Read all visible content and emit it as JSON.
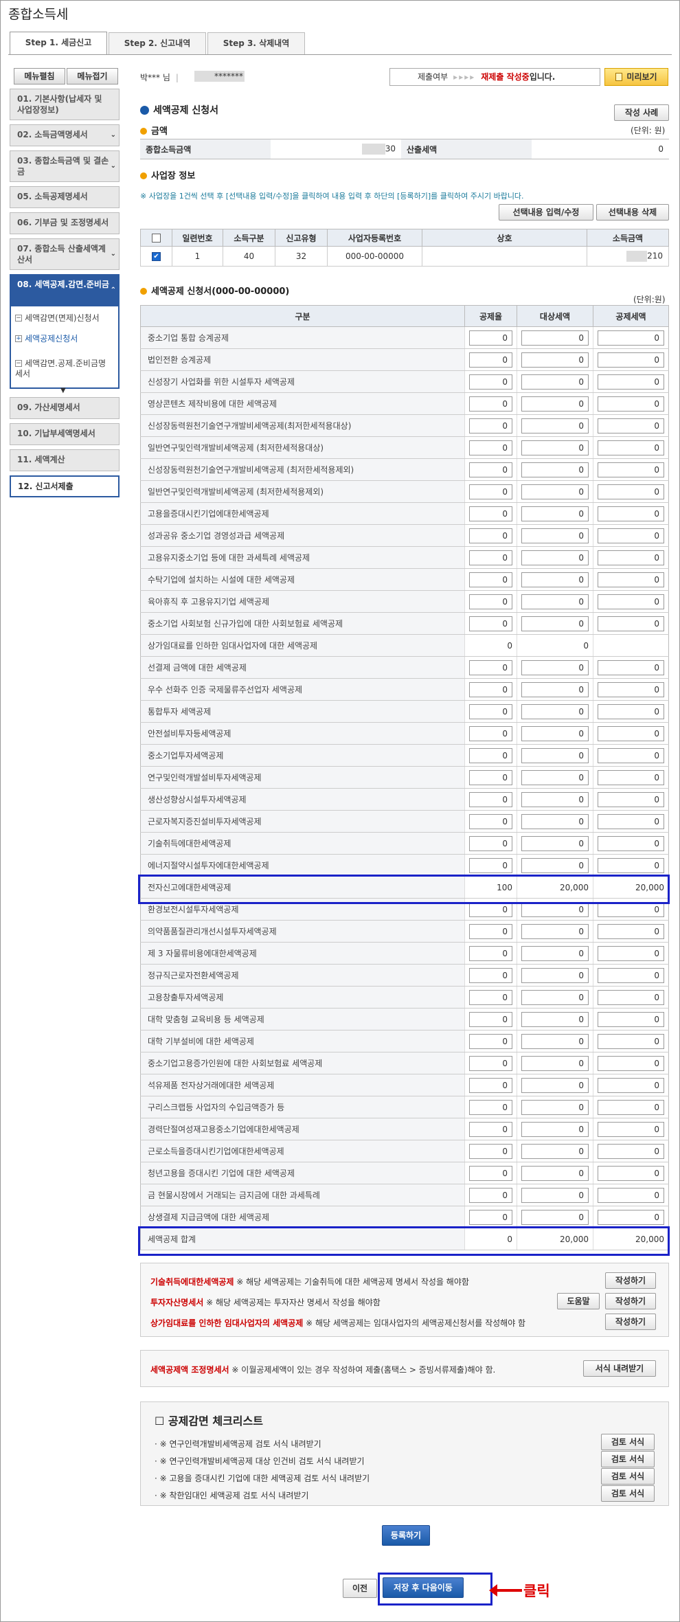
{
  "page_title": "종합소득세",
  "tabs": [
    {
      "label": "Step 1. 세금신고"
    },
    {
      "label": "Step 2. 신고내역"
    },
    {
      "label": "Step 3. 삭제내역"
    }
  ],
  "left_menu": {
    "expand_label": "메뉴펼침",
    "collapse_label": "메뉴접기",
    "items": [
      {
        "label": "01. 기본사항(납세자 및 사업장정보)"
      },
      {
        "label": "02. 소득금액명세서"
      },
      {
        "label": "03. 종합소득금액 및 결손금"
      },
      {
        "label": "05. 소득공제명세서"
      },
      {
        "label": "06. 기부금 및 조정명세서"
      },
      {
        "label": "07. 종합소득 산출세액계산서"
      },
      {
        "label": "08. 세액공제.감면.준비금"
      },
      {
        "label": "09. 가산세명세서"
      },
      {
        "label": "10. 기납부세액명세서"
      },
      {
        "label": "11. 세액계산"
      },
      {
        "label": "12. 신고서제출"
      }
    ],
    "submenu": [
      {
        "label": "세액감면(면제)신청서"
      },
      {
        "label": "세액공제신청서"
      },
      {
        "label": "세액감면.공제.준비금명세서"
      }
    ]
  },
  "header": {
    "user_name": "박*** 님",
    "user_id": "*******",
    "status_label": "제출여부",
    "status_arrows": "▸▸▸▸",
    "status_value": "재제출 작성중",
    "status_suffix": "입니다.",
    "preview_label": "미리보기"
  },
  "section1": {
    "title": "세액공제 신청서",
    "sample_button": "작성 사례",
    "amount_title": "금액",
    "unit": "(단위: 원)",
    "income_label": "종합소득금액",
    "income_value": "30",
    "calc_tax_label": "산출세액",
    "calc_tax_value": "0"
  },
  "biz": {
    "title": "사업장 정보",
    "notice": "※ 사업장을 1건씩 선택 후 [선택내용 입력/수정]을 클릭하여 내용 입력 후 하단의 [등록하기]를 클릭하여 주시기 바랍니다.",
    "btn_edit": "선택내용 입력/수정",
    "btn_delete": "선택내용 삭제",
    "columns": [
      "일련번호",
      "소득구분",
      "신고유형",
      "사업자등록번호",
      "상호",
      "소득금액"
    ],
    "row": {
      "serial": "1",
      "income_type": "40",
      "report_type": "32",
      "reg_no": "000-00-00000",
      "trade_name": "",
      "amount": "210"
    }
  },
  "credit": {
    "title": "세액공제 신청서(000-00-00000)",
    "unit": "(단위:원)",
    "columns": [
      "구분",
      "공제율",
      "대상세액",
      "공제세액"
    ],
    "rows": [
      {
        "name": "중소기업 통합 승계공제",
        "rate": "0",
        "target": "0",
        "credit": "0",
        "input": true
      },
      {
        "name": "법인전환 승계공제",
        "rate": "0",
        "target": "0",
        "credit": "0",
        "input": true
      },
      {
        "name": "신성장기 사업화를 위한 시설투자 세액공제",
        "rate": "0",
        "target": "0",
        "credit": "0",
        "input": true
      },
      {
        "name": "영상콘텐츠 제작비용에 대한 세액공제",
        "rate": "0",
        "target": "0",
        "credit": "0",
        "input": true
      },
      {
        "name": "신성장동력원천기술연구개발비세액공제(최저한세적용대상)",
        "rate": "0",
        "target": "0",
        "credit": "0",
        "input": true
      },
      {
        "name": "일반연구및인력개발비세액공제 (최저한세적용대상)",
        "rate": "0",
        "target": "0",
        "credit": "0",
        "input": true
      },
      {
        "name": "신성장동력원천기술연구개발비세액공제 (최저한세적용제외)",
        "rate": "0",
        "target": "0",
        "credit": "0",
        "input": true
      },
      {
        "name": "일반연구및인력개발비세액공제 (최저한세적용제외)",
        "rate": "0",
        "target": "0",
        "credit": "0",
        "input": true
      },
      {
        "name": "고용을증대시킨기업에대한세액공제",
        "rate": "0",
        "target": "0",
        "credit": "0",
        "input": true
      },
      {
        "name": "성과공유 중소기업 경영성과급 세액공제",
        "rate": "0",
        "target": "0",
        "credit": "0",
        "input": true
      },
      {
        "name": "고용유지중소기업 등에 대한 과세특례 세액공제",
        "rate": "0",
        "target": "0",
        "credit": "0",
        "input": true
      },
      {
        "name": "수탁기업에 설치하는 시설에 대한 세액공제",
        "rate": "0",
        "target": "0",
        "credit": "0",
        "input": true
      },
      {
        "name": "육아휴직 후 고용유지기업 세액공제",
        "rate": "0",
        "target": "0",
        "credit": "0",
        "input": true
      },
      {
        "name": "중소기업 사회보험 신규가입에 대한 사회보험료 세액공제",
        "rate": "0",
        "target": "0",
        "credit": "0",
        "input": true
      },
      {
        "name": "상가임대료를 인하한 임대사업자에 대한 세액공제",
        "rate": "0",
        "target": "0",
        "credit": "",
        "input": false
      },
      {
        "name": "선결제 금액에 대한 세액공제",
        "rate": "0",
        "target": "0",
        "credit": "0",
        "input": true
      },
      {
        "name": "우수 선화주 인증 국제물류주선업자 세액공제",
        "rate": "0",
        "target": "0",
        "credit": "0",
        "input": true
      },
      {
        "name": "통합투자 세액공제",
        "rate": "0",
        "target": "0",
        "credit": "0",
        "input": true
      },
      {
        "name": "안전설비투자등세액공제",
        "rate": "0",
        "target": "0",
        "credit": "0",
        "input": true
      },
      {
        "name": "중소기업투자세액공제",
        "rate": "0",
        "target": "0",
        "credit": "0",
        "input": true
      },
      {
        "name": "연구및인력개발설비투자세액공제",
        "rate": "0",
        "target": "0",
        "credit": "0",
        "input": true
      },
      {
        "name": "생산성향상시설투자세액공제",
        "rate": "0",
        "target": "0",
        "credit": "0",
        "input": true
      },
      {
        "name": "근로자복지증진설비투자세액공제",
        "rate": "0",
        "target": "0",
        "credit": "0",
        "input": true
      },
      {
        "name": "기술취득에대한세액공제",
        "rate": "0",
        "target": "0",
        "credit": "0",
        "input": true
      },
      {
        "name": "에너지절약시설투자에대한세액공제",
        "rate": "0",
        "target": "0",
        "credit": "0",
        "input": true
      },
      {
        "name": "전자신고에대한세액공제",
        "rate": "100",
        "target": "20,000",
        "credit": "20,000",
        "input": false
      },
      {
        "name": "환경보전시설투자세액공제",
        "rate": "0",
        "target": "0",
        "credit": "0",
        "input": true
      },
      {
        "name": "의약품품질관리개선시설투자세액공제",
        "rate": "0",
        "target": "0",
        "credit": "0",
        "input": true
      },
      {
        "name": "제 3 자물류비용에대한세액공제",
        "rate": "0",
        "target": "0",
        "credit": "0",
        "input": true
      },
      {
        "name": "정규직근로자전환세액공제",
        "rate": "0",
        "target": "0",
        "credit": "0",
        "input": true
      },
      {
        "name": "고용창출투자세액공제",
        "rate": "0",
        "target": "0",
        "credit": "0",
        "input": true
      },
      {
        "name": "대학 맞춤형 교육비용 등 세액공제",
        "rate": "0",
        "target": "0",
        "credit": "0",
        "input": true
      },
      {
        "name": "대학 기부설비에 대한 세액공제",
        "rate": "0",
        "target": "0",
        "credit": "0",
        "input": true
      },
      {
        "name": "중소기업고용증가인원에 대한 사회보험료 세액공제",
        "rate": "0",
        "target": "0",
        "credit": "0",
        "input": true
      },
      {
        "name": "석유제품 전자상거래에대한 세액공제",
        "rate": "0",
        "target": "0",
        "credit": "0",
        "input": true
      },
      {
        "name": "구리스크랩등 사업자의 수입금액증가 등",
        "rate": "0",
        "target": "0",
        "credit": "0",
        "input": true
      },
      {
        "name": "경력단절여성재고용중소기업에대한세액공제",
        "rate": "0",
        "target": "0",
        "credit": "0",
        "input": true
      },
      {
        "name": "근로소득을증대시킨기업에대한세액공제",
        "rate": "0",
        "target": "0",
        "credit": "0",
        "input": true
      },
      {
        "name": "청년고용을 증대시킨 기업에 대한 세액공제",
        "rate": "0",
        "target": "0",
        "credit": "0",
        "input": true
      },
      {
        "name": "금 현물시장에서 거래되는 금지금에 대한 과세특례",
        "rate": "0",
        "target": "0",
        "credit": "0",
        "input": true
      },
      {
        "name": "상생결제 지급금액에 대한 세액공제",
        "rate": "0",
        "target": "0",
        "credit": "0",
        "input": true
      },
      {
        "name": "세액공제 합계",
        "rate": "0",
        "target": "20,000",
        "credit": "20,000",
        "input": false
      }
    ]
  },
  "forms": {
    "lines": [
      {
        "title": "기술취득에대한세액공제",
        "text": " ※ 해당 세액공제는 기술취득에 대한 세액공제 명세서 작성을 해야함"
      },
      {
        "title": "투자자산명세서",
        "text": " ※ 해당 세액공제는 투자자산 명세서 작성을 해야함"
      },
      {
        "title": "상가임대료를 인하한 임대사업자의 세액공제",
        "text": " ※ 해당 세액공제는 임대사업자의 세액공제신청서를 작성해야 함"
      }
    ],
    "write_label": "작성하기",
    "help_label": "도움말"
  },
  "adjust": {
    "title": "세액공제액 조정명세서",
    "text": " ※ 이월공제세액이 있는 경우 작성하여 제출(홈택스 > 증빙서류제출)해야 함.",
    "button": "서식 내려받기"
  },
  "checklist": {
    "title": "☐ 공제감면 체크리스트",
    "items": [
      "· ※ 연구인력개발비세액공제 검토 서식 내려받기",
      "· ※ 연구인력개발비세액공제 대상 인건비 검토 서식 내려받기",
      "· ※ 고용을 증대시킨 기업에 대한 세액공제 검토 서식 내려받기",
      "· ※ 착한임대인 세액공제 검토 서식 내려받기"
    ],
    "button": "검토 서식"
  },
  "bottom": {
    "register": "등록하기",
    "prev": "이전",
    "save_next": "저장 후 다음이동",
    "annotation": "클릭"
  }
}
